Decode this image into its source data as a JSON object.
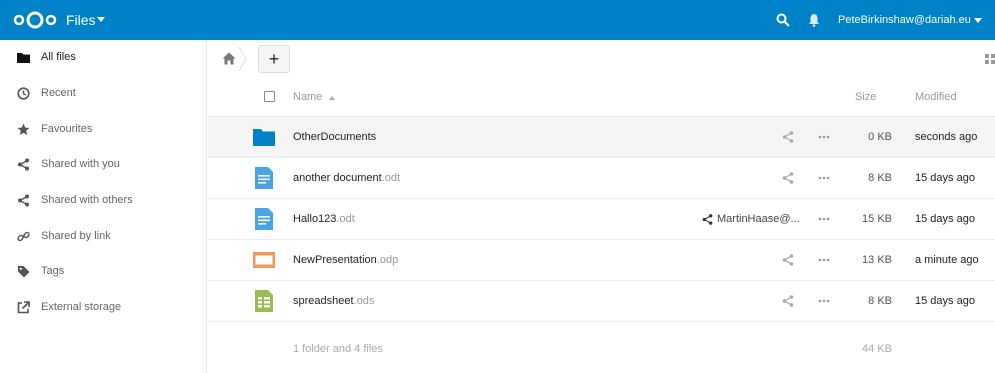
{
  "header": {
    "app_title": "Files",
    "user": "PeteBirkinshaw@dariah.eu",
    "brand_color": "#0082c9"
  },
  "sidebar": {
    "items": [
      {
        "label": "All files",
        "icon": "folder-icon",
        "active": true
      },
      {
        "label": "Recent",
        "icon": "clock-icon"
      },
      {
        "label": "Favourites",
        "icon": "star-icon"
      },
      {
        "label": "Shared with you",
        "icon": "share-icon"
      },
      {
        "label": "Shared with others",
        "icon": "share-icon"
      },
      {
        "label": "Shared by link",
        "icon": "link-icon"
      },
      {
        "label": "Tags",
        "icon": "tag-icon"
      },
      {
        "label": "External storage",
        "icon": "external-icon"
      }
    ]
  },
  "toolbar": {
    "add_label": "+"
  },
  "table": {
    "columns": {
      "name": "Name",
      "size": "Size",
      "modified": "Modified"
    },
    "rows": [
      {
        "name": "OtherDocuments",
        "ext": "",
        "type": "folder",
        "size": "0 KB",
        "modified": "seconds ago"
      },
      {
        "name": "another document",
        "ext": ".odt",
        "type": "document",
        "size": "8 KB",
        "modified": "15 days ago"
      },
      {
        "name": "Hallo123",
        "ext": ".odt",
        "type": "document",
        "size": "15 KB",
        "modified": "15 days ago",
        "shared_with": "MartinHaase@..."
      },
      {
        "name": "NewPresentation",
        "ext": ".odp",
        "type": "presentation",
        "size": "13 KB",
        "modified": "a minute ago"
      },
      {
        "name": "spreadsheet",
        "ext": ".ods",
        "type": "spreadsheet",
        "size": "8 KB",
        "modified": "15 days ago"
      }
    ],
    "summary": "1 folder and 4 files",
    "summary_size": "44 KB"
  },
  "colors": {
    "folder": "#0082c9",
    "document": "#49a4e6",
    "presentation": "#f09a63",
    "spreadsheet": "#9abd4e"
  }
}
